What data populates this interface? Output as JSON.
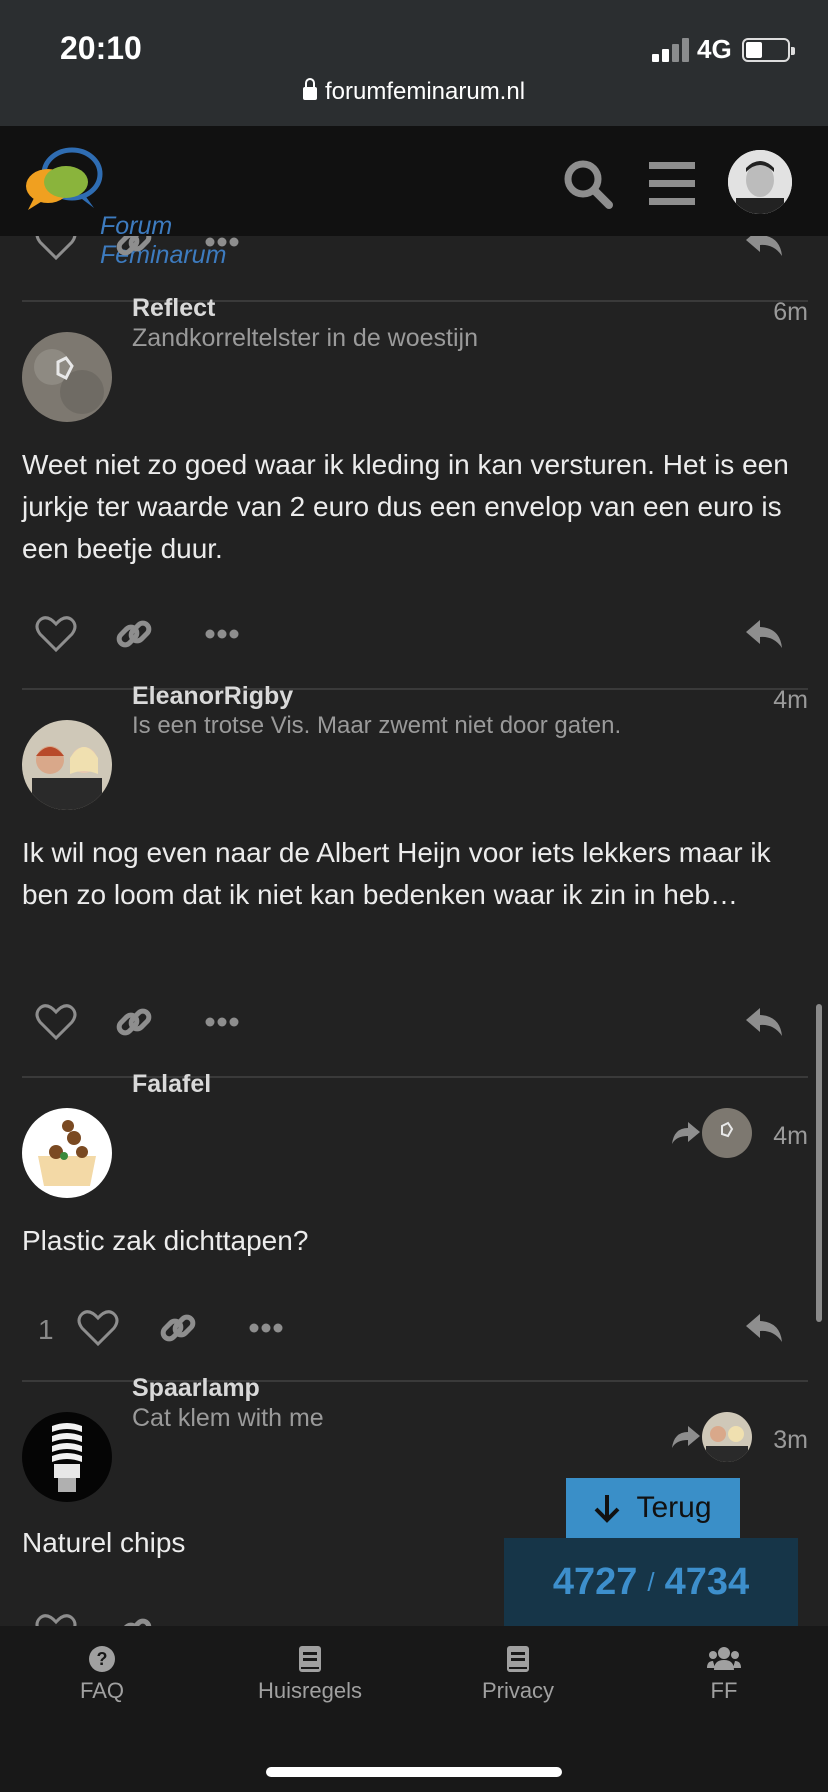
{
  "status_bar": {
    "time": "20:10",
    "network": "4G"
  },
  "browser": {
    "url": "forumfeminarum.nl"
  },
  "header": {
    "logo_text": "Forum Feminarum"
  },
  "posts": [
    {
      "username": "Reflect",
      "user_title": "Zandkorreltelster in de woestijn",
      "time": "6m",
      "body": "Weet niet zo goed waar ik kleding in kan versturen. Het is een jurkje ter waarde van 2 euro dus een envelop van een euro is een beetje duur."
    },
    {
      "username": "EleanorRigby",
      "user_title": "Is een trotse Vis. Maar zwemt niet door gaten.",
      "time": "4m",
      "body": "Ik wil nog even naar de Albert Heijn voor iets lekkers maar ik ben zo loom dat ik niet kan bedenken waar ik zin in heb…"
    },
    {
      "username": "Falafel",
      "user_title": "",
      "time": "4m",
      "body": "Plastic zak dichttapen?",
      "like_count": "1"
    },
    {
      "username": "Spaarlamp",
      "user_title": "Cat klem with me",
      "time": "3m",
      "body": "Naturel chips"
    }
  ],
  "timeline": {
    "back_label": "Terug",
    "current": "4727",
    "separator": "/",
    "total": "4734"
  },
  "bottom_nav": [
    {
      "label": "FAQ",
      "icon": "question-circle-icon"
    },
    {
      "label": "Huisregels",
      "icon": "book-icon"
    },
    {
      "label": "Privacy",
      "icon": "book-icon"
    },
    {
      "label": "FF",
      "icon": "users-icon"
    }
  ],
  "colors": {
    "background": "#222222",
    "header": "#111111",
    "accent": "#3a8fc8",
    "counter_bg": "#163548"
  }
}
